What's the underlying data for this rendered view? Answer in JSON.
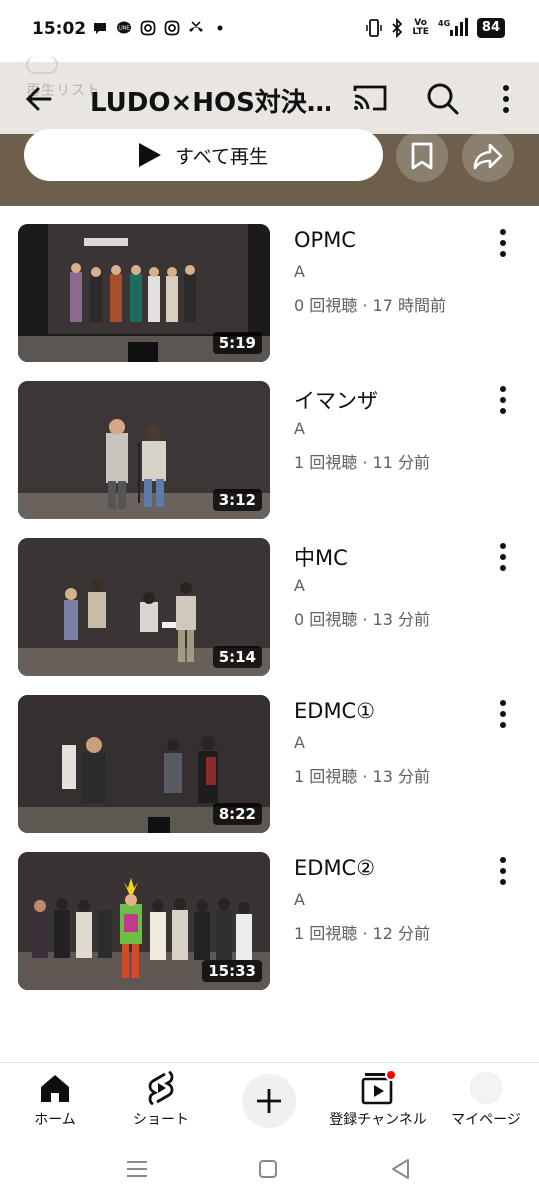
{
  "status": {
    "time": "15:02",
    "battery": "84",
    "volte": "Vo\nLTE",
    "net": "4G"
  },
  "header": {
    "title": "LUDO×HOS対決…",
    "ghost_text": "再生リスト"
  },
  "actions": {
    "play_all": "すべて再生"
  },
  "videos": [
    {
      "title": "OPMC",
      "channel": "A",
      "meta": "0 回視聴 · 17 時間前",
      "duration": "5:19"
    },
    {
      "title": "イマンザ",
      "channel": "A",
      "meta": "1 回視聴 · 11 分前",
      "duration": "3:12"
    },
    {
      "title": "中MC",
      "channel": "A",
      "meta": "0 回視聴 · 13 分前",
      "duration": "5:14"
    },
    {
      "title": "EDMC①",
      "channel": "A",
      "meta": "1 回視聴 · 13 分前",
      "duration": "8:22"
    },
    {
      "title": "EDMC②",
      "channel": "A",
      "meta": "1 回視聴 · 12 分前",
      "duration": "15:33"
    }
  ],
  "nav": {
    "home": "ホーム",
    "shorts": "ショート",
    "subscriptions": "登録チャンネル",
    "you": "マイページ"
  },
  "colors": {
    "band": "#6e5f4c",
    "header_bg": "#e9e5e0",
    "notification_dot": "#ff0000"
  }
}
